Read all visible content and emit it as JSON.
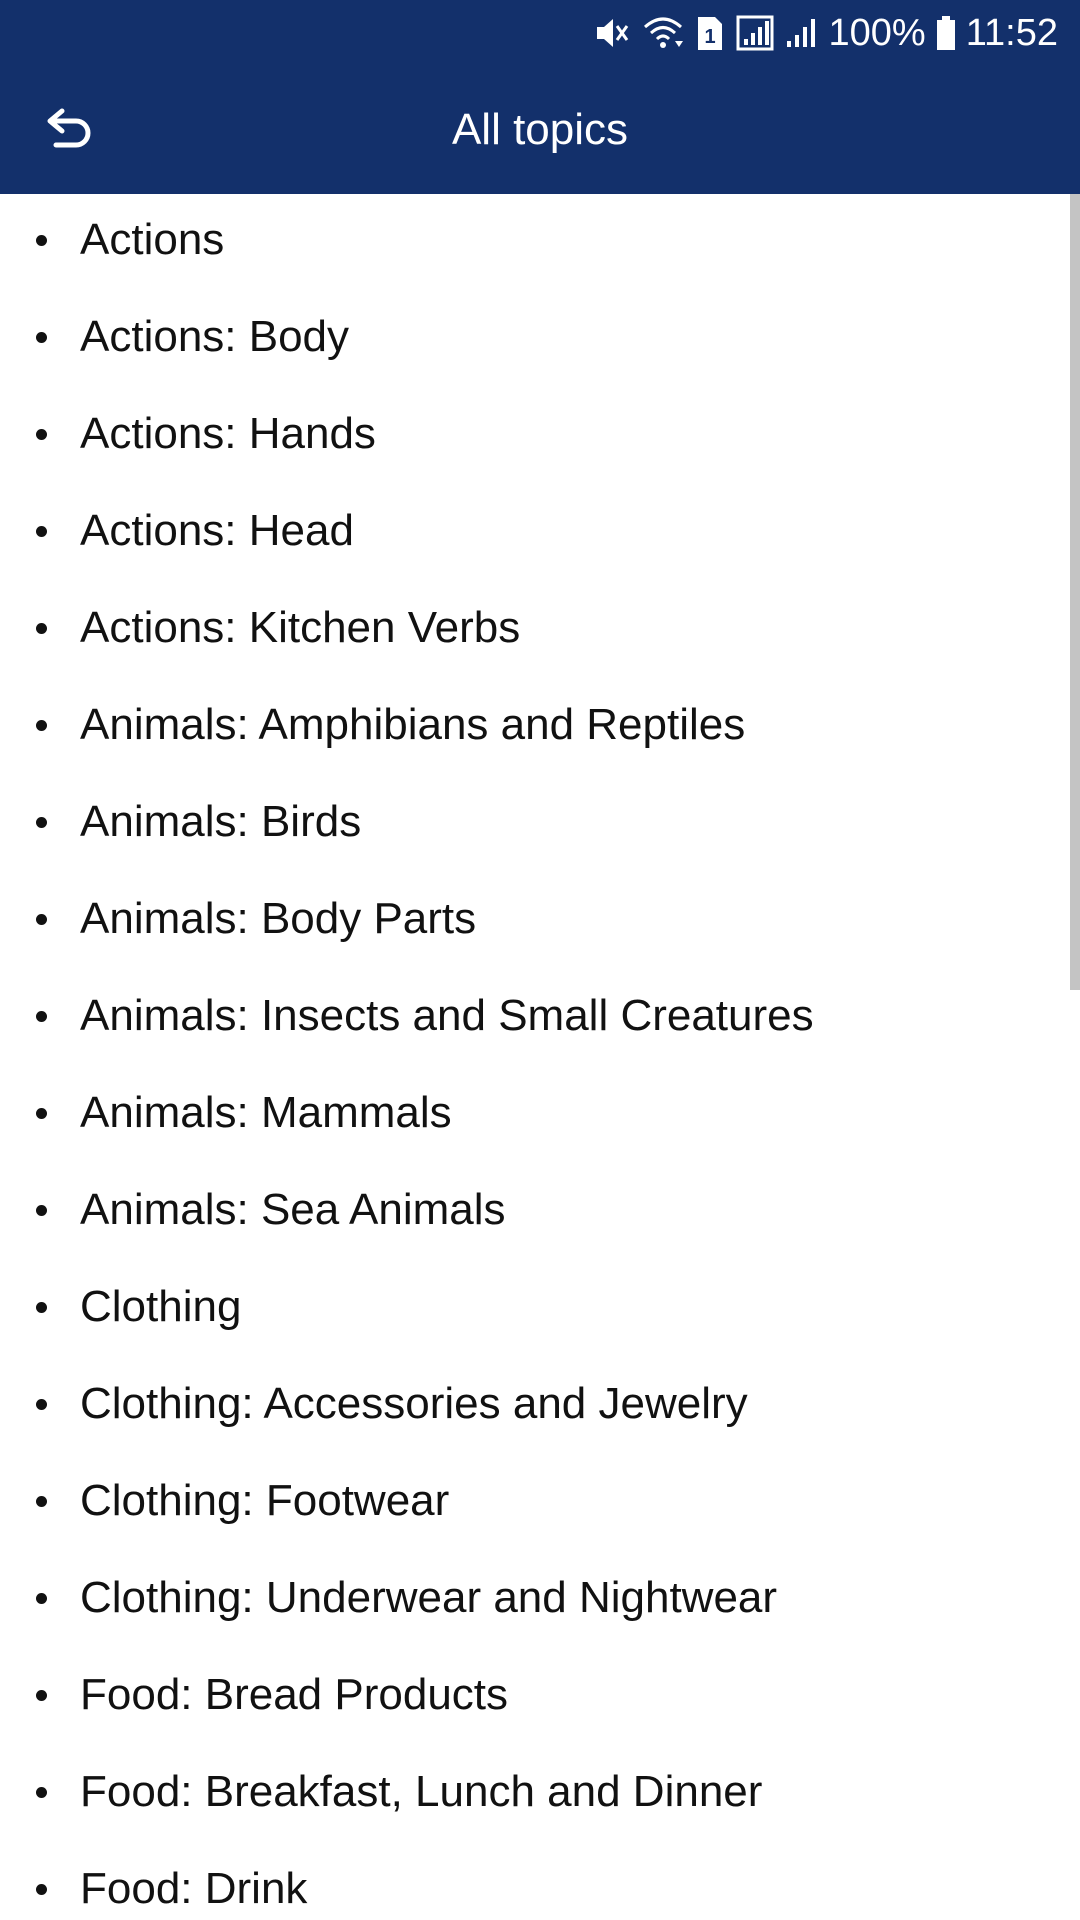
{
  "status_bar": {
    "battery": "100%",
    "time": "11:52",
    "sim_label": "1",
    "icons": [
      "mute-icon",
      "wifi-icon",
      "sim-icon",
      "signal-icon",
      "signal-weak-icon",
      "battery-icon"
    ]
  },
  "app_bar": {
    "title": "All topics",
    "back_icon": "back-arrow-icon",
    "background_color": "#13306b"
  },
  "topics": [
    "Actions",
    "Actions: Body",
    "Actions: Hands",
    "Actions: Head",
    "Actions: Kitchen Verbs",
    "Animals: Amphibians and Reptiles",
    "Animals: Birds",
    "Animals: Body Parts",
    "Animals: Insects and Small Creatures",
    "Animals: Mammals",
    "Animals: Sea Animals",
    "Clothing",
    "Clothing: Accessories and Jewelry",
    "Clothing: Footwear",
    "Clothing: Underwear and Nightwear",
    "Food: Bread Products",
    "Food: Breakfast, Lunch and Dinner",
    "Food: Drink"
  ]
}
